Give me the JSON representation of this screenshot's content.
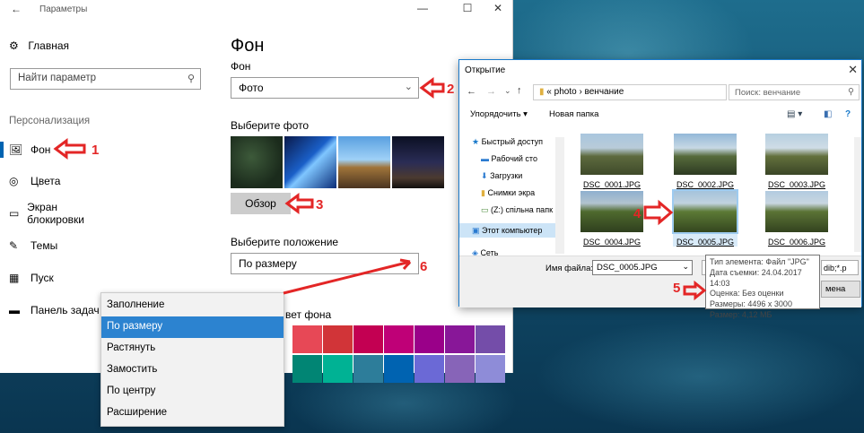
{
  "settings": {
    "window_title": "Параметры",
    "home_label": "Главная",
    "search_placeholder": "Найти параметр",
    "section_label": "Персонализация",
    "nav": [
      {
        "label": "Фон"
      },
      {
        "label": "Цвета"
      },
      {
        "label": "Экран блокировки"
      },
      {
        "label": "Темы"
      },
      {
        "label": "Пуск"
      },
      {
        "label": "Панель задач"
      }
    ],
    "page_title": "Фон",
    "bg_label": "Фон",
    "bg_value": "Фото",
    "choose_photo_label": "Выберите фото",
    "browse_label": "Обзор",
    "position_label": "Выберите положение",
    "position_value": "По размеру",
    "bg_color_label": "вет фона",
    "position_options": [
      "Заполнение",
      "По размеру",
      "Растянуть",
      "Замостить",
      "По центру",
      "Расширение"
    ],
    "selected_option": "По размеру",
    "swatch_colors": [
      "#e74856",
      "#d13438",
      "#c30052",
      "#bf0077",
      "#9a0089",
      "#881798",
      "#744da9",
      "#018574",
      "#00b294",
      "#2d7d9a",
      "#0063b1",
      "#6b69d6",
      "#8764b8",
      "#8e8cd8",
      "#b146c2"
    ]
  },
  "dialog": {
    "title": "Открытие",
    "address": "« photo › венчание",
    "search_placeholder": "Поиск: венчание",
    "organize_label": "Упорядочить ▾",
    "new_folder_label": "Новая папка",
    "tree": [
      {
        "label": "Быстрый доступ"
      },
      {
        "label": "Рабочий сто"
      },
      {
        "label": "Загрузки"
      },
      {
        "label": "Снимки экра"
      },
      {
        "label": "(Z:) спільна папк"
      },
      {
        "label": "Этот компьютер"
      },
      {
        "label": "Сеть"
      }
    ],
    "files": [
      {
        "name": "DSC_0001.JPG"
      },
      {
        "name": "DSC_0002.JPG"
      },
      {
        "name": "DSC_0003.JPG"
      },
      {
        "name": "DSC_0004.JPG"
      },
      {
        "name": "DSC_0005.JPG"
      },
      {
        "name": "DSC_0006.JPG"
      }
    ],
    "filename_label": "Имя файла:",
    "filename_value": "DSC_0005.JPG",
    "filter_value": "dib;*.p",
    "open_button_partial": "мена",
    "tooltip": [
      "Тип элемента: Файл \"JPG\"",
      "Дата съемки: 24.04.2017 14:03",
      "Оценка: Без оценки",
      "Размеры: 4496 x 3000",
      "Размер: 4,12 МБ"
    ]
  },
  "annotations": [
    "1",
    "2",
    "3",
    "4",
    "5",
    "6"
  ]
}
